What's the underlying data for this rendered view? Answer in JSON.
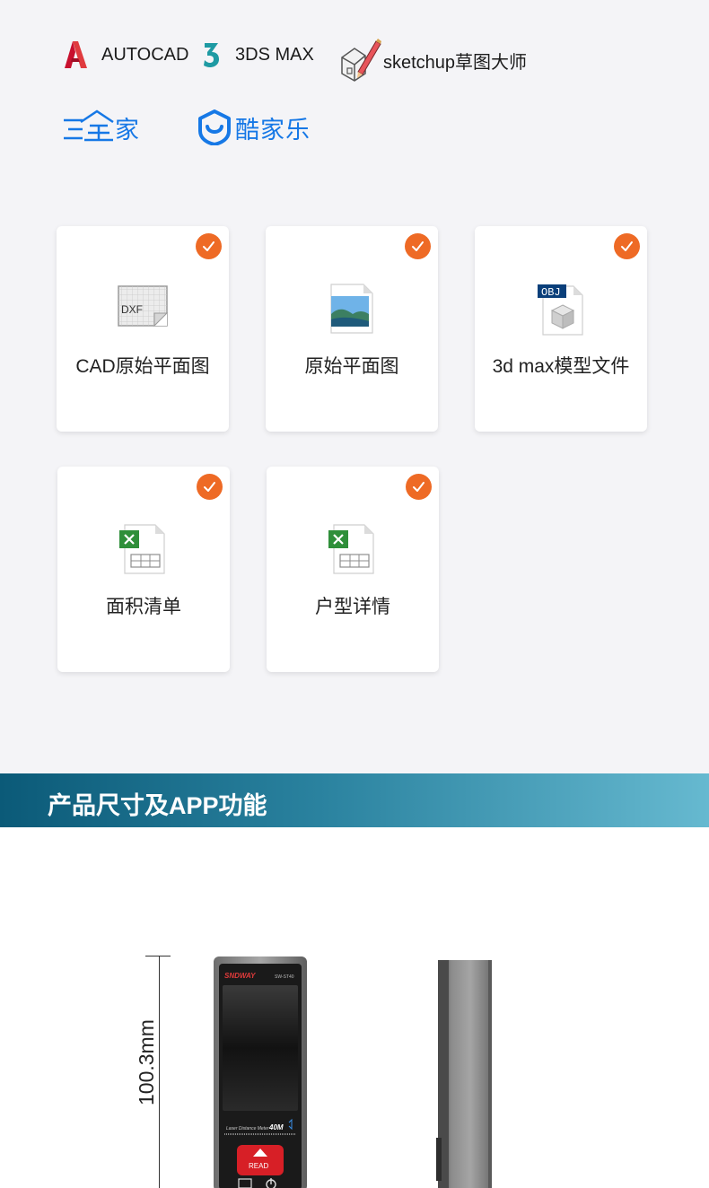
{
  "software": {
    "autocad": "AUTOCAD",
    "max3ds": "3DS MAX",
    "sketchup": "sketchup草图大师",
    "three_d_home": "家",
    "kujiale": "酷家乐"
  },
  "exports": [
    {
      "label": "CAD原始平面图",
      "icon": "dxf-file-icon"
    },
    {
      "label": "原始平面图",
      "icon": "image-file-icon"
    },
    {
      "label": "3d max模型文件",
      "icon": "obj-file-icon",
      "badge": "OBJ"
    },
    {
      "label": "面积清单",
      "icon": "excel-file-icon"
    },
    {
      "label": "户型详情",
      "icon": "excel-file-icon"
    }
  ],
  "dxf_badge": "DXF",
  "section_title": "产品尺寸及APP功能",
  "product": {
    "dimension": "100.3mm",
    "brand": "SNDWAY",
    "model": "SW-ST40",
    "subtitle": "Laser Distance Meter",
    "range": "40M",
    "read_button": "READ"
  },
  "colors": {
    "accent_check": "#ee6a25",
    "brand_blue": "#1678e6",
    "banner_dark": "#0b5a78",
    "banner_light": "#66b9d0"
  }
}
